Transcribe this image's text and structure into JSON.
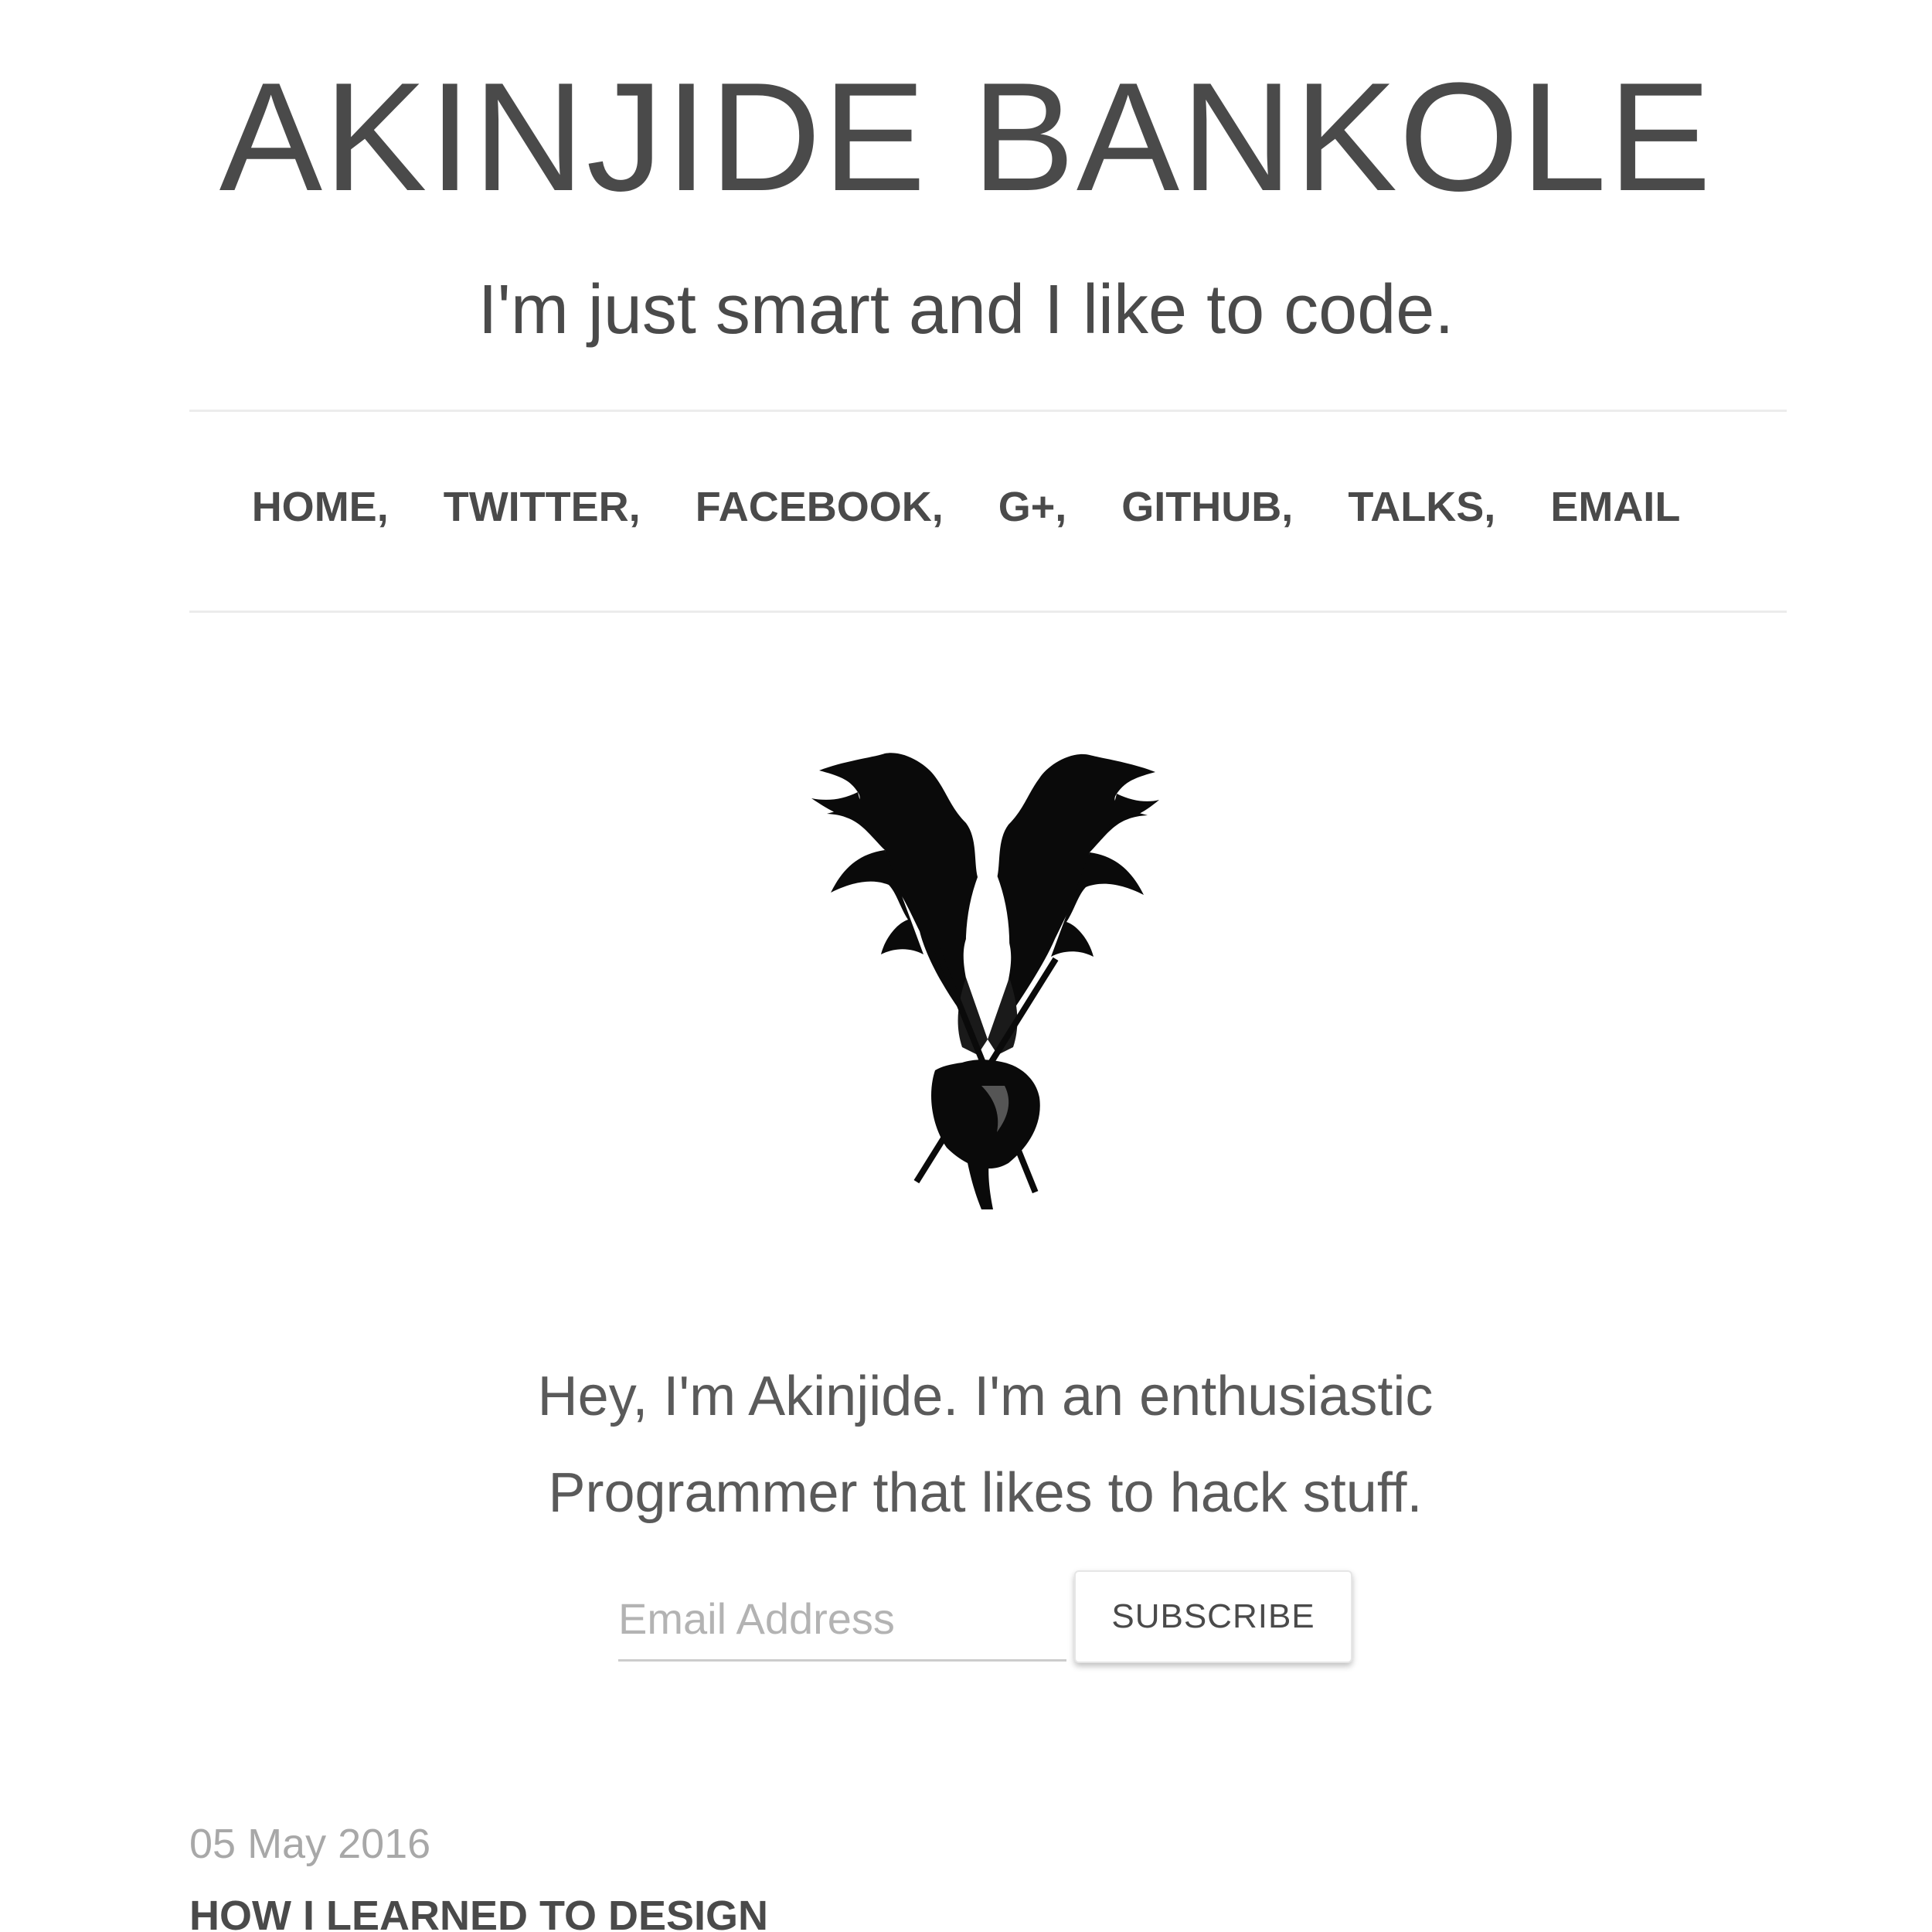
{
  "site": {
    "title": "AKINJIDE BANKOLE",
    "tagline": "I'm just smart and I like to code."
  },
  "nav": {
    "items": [
      {
        "label": "HOME,"
      },
      {
        "label": "TWITTER,"
      },
      {
        "label": "FACEBOOK,"
      },
      {
        "label": "G+,"
      },
      {
        "label": "GITHUB,"
      },
      {
        "label": "TALKS,"
      },
      {
        "label": "EMAIL"
      }
    ]
  },
  "logo": {
    "icon": "winged-figure-logo"
  },
  "intro": {
    "line1": "Hey, I'm Akinjide. I'm an enthusiastic",
    "line2": "Programmer that likes to hack stuff."
  },
  "subscribe": {
    "placeholder": "Email Address",
    "button_label": "SUBSCRIBE"
  },
  "posts": [
    {
      "date": "05 May 2016",
      "title": "HOW I LEARNED TO DESIGN"
    }
  ]
}
